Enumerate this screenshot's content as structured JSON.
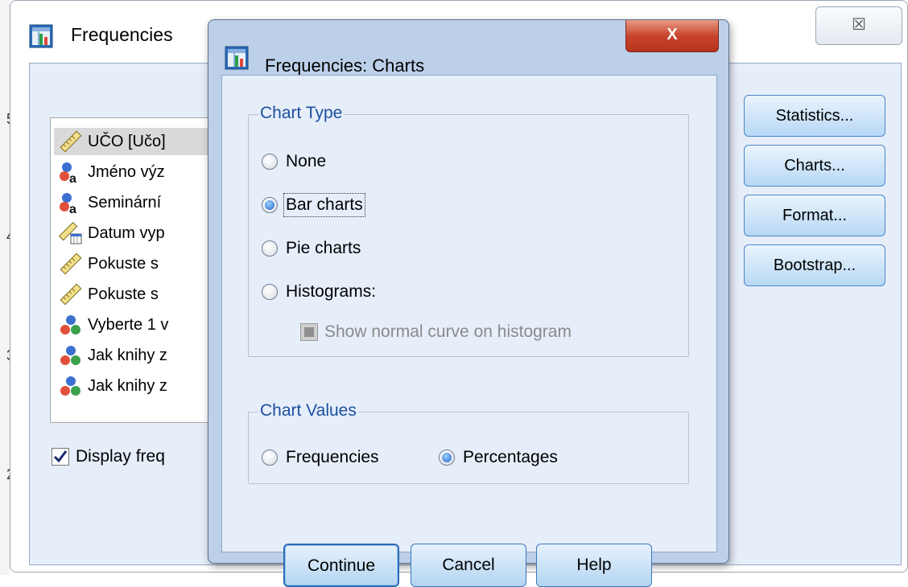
{
  "background_window": {
    "title": "Frequencies",
    "close_glyph": "☒",
    "ruler_numbers": [
      "5",
      "4",
      "3",
      "2"
    ],
    "variables": [
      {
        "label": "UČO [Učo]",
        "icon": "ruler-scale-icon",
        "selected": true
      },
      {
        "label": "Jméno výz",
        "icon": "nominal-string-icon"
      },
      {
        "label": "Seminární",
        "icon": "nominal-string-icon"
      },
      {
        "label": "Datum vyp",
        "icon": "date-scale-icon"
      },
      {
        "label": "Pokuste s",
        "icon": "ruler-scale-icon"
      },
      {
        "label": "Pokuste s",
        "icon": "ruler-scale-icon"
      },
      {
        "label": "Vyberte 1 v",
        "icon": "nominal-icon"
      },
      {
        "label": "Jak knihy z",
        "icon": "nominal-icon"
      },
      {
        "label": "Jak knihy z",
        "icon": "nominal-icon"
      }
    ],
    "display_freq_label": "Display freq",
    "display_freq_checked": true,
    "side_buttons": {
      "statistics": "Statistics...",
      "charts": "Charts...",
      "format": "Format...",
      "bootstrap": "Bootstrap..."
    }
  },
  "dialog": {
    "title": "Frequencies: Charts",
    "close_glyph": "X",
    "chart_type": {
      "legend": "Chart Type",
      "options": {
        "none": "None",
        "bar": "Bar charts",
        "pie": "Pie charts",
        "histograms": "Histograms:"
      },
      "selected": "bar",
      "show_normal_curve": "Show normal curve on histogram"
    },
    "chart_values": {
      "legend": "Chart Values",
      "frequencies": "Frequencies",
      "percentages": "Percentages",
      "selected": "percentages"
    },
    "buttons": {
      "continue": "Continue",
      "cancel": "Cancel",
      "help": "Help"
    }
  }
}
